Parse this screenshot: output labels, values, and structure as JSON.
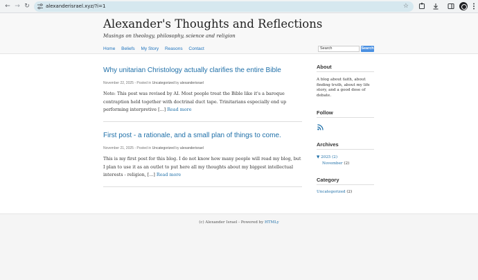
{
  "browser": {
    "back_glyph": "←",
    "forward_glyph": "→",
    "reload_glyph": "↻",
    "url": "alexanderisrael.xyz/?i=1",
    "star_glyph": "☆",
    "icons": [
      "tune-icon",
      "star-icon",
      "extensions-icon",
      "download-icon",
      "ext-badge-icon",
      "menu-icon"
    ]
  },
  "header": {
    "title": "Alexander's Thoughts and Reflections",
    "tagline": "Musings on theology, philosophy, science and religion",
    "nav": [
      "Home",
      "Beliefs",
      "My Story",
      "Reasons",
      "Contact"
    ],
    "search_value": "Search",
    "search_button": "Search"
  },
  "posts": [
    {
      "title": "Why unitarian Christology actually clarifies the entire Bible",
      "date": "November 22, 2025",
      "posted_in": "- Posted in",
      "category": "Uncategorized",
      "by": "by",
      "author": "alexanderisrael",
      "excerpt": "Note: This post was revised by AI. Most people treat the Bible like it's a baroque contraption held together with doctrinal duct tape. Trinitarians especially end up performing interpretive [...]",
      "read_more": "Read more"
    },
    {
      "title": "First post - a rationale, and a small plan of things to come.",
      "date": "November 21, 2025",
      "posted_in": "- Posted in",
      "category": "Uncategorized",
      "by": "by",
      "author": "alexanderisrael",
      "excerpt": "This is my first post for this blog. I do not know how many people will read my blog, but I plan to use it as an outlet to put here all my thoughts about my biggest intellectual interests - religion, [...]",
      "read_more": "Read more"
    }
  ],
  "sidebar": {
    "about_heading": "About",
    "about_text": "A blog about faith, about finding truth, about my life story, and a good dose of debate.",
    "follow_heading": "Follow",
    "archives_heading": "Archives",
    "archive_year": "▼ 2025 (2)",
    "archive_month": "November",
    "archive_month_count": "(2)",
    "category_heading": "Category",
    "category_name": "Uncategorized",
    "category_count": "(2)"
  },
  "footer": {
    "prefix": "(c) Alexander Israel - Powered by",
    "powered_link": "HTMLy"
  },
  "colors": {
    "link": "#1e6fa8",
    "search_button": "#4a90e2",
    "rss": "#1e6fa8"
  }
}
